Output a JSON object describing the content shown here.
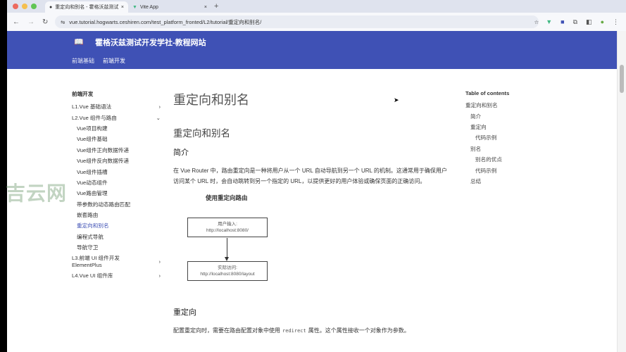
{
  "browser": {
    "tabs": [
      {
        "title": "重定向和别名 - 霍格沃兹测试开发学社",
        "active": true
      },
      {
        "title": "Vite App",
        "active": false
      }
    ],
    "url": "vue.tutorial.hogwarts.ceshiren.com/test_platform_fronted/L2/tutorial/重定向和别名/"
  },
  "header": {
    "site_title": "霍格沃兹测试开发学社-教程网站",
    "nav": [
      "前端基础",
      "前端开发"
    ]
  },
  "sidebar": {
    "heading": "前端开发",
    "items": [
      {
        "label": "L1.Vue 基础语法",
        "chevron": "›"
      },
      {
        "label": "L2.Vue 组件与路由",
        "chevron": "⌄"
      },
      {
        "label": "Vue项目构建",
        "sub": true
      },
      {
        "label": "Vue组件基础",
        "sub": true
      },
      {
        "label": "Vue组件正向数据传递",
        "sub": true
      },
      {
        "label": "Vue组件反向数据传递",
        "sub": true
      },
      {
        "label": "Vue组件插槽",
        "sub": true
      },
      {
        "label": "Vue动态组件",
        "sub": true
      },
      {
        "label": "Vue路由管理",
        "sub": true
      },
      {
        "label": "带参数的动态路由匹配",
        "sub": true
      },
      {
        "label": "嵌套路由",
        "sub": true
      },
      {
        "label": "重定向和别名",
        "sub": true,
        "active": true
      },
      {
        "label": "编程式导航",
        "sub": true
      },
      {
        "label": "导航守卫",
        "sub": true
      },
      {
        "label": "L3.前端 UI 组件开发 ElementPlus",
        "chevron": "›"
      },
      {
        "label": "L4.Vue UI 组件库",
        "chevron": "›"
      }
    ]
  },
  "main": {
    "title": "重定向和别名",
    "h2": "重定向和别名",
    "intro_heading": "简介",
    "intro_text": "在 Vue Router 中，路由重定向是一种将用户从一个 URL 自动导航到另一个 URL 的机制。这通常用于确保用户访问某个 URL 时，会自动跳转到另一个指定的 URL，以提供更好的用户体验或确保页面的正确访问。",
    "figure": {
      "title": "使用重定向路由",
      "box1_label": "用户输入:",
      "box1_url": "http://localhost:8080/",
      "box2_label": "实际访问:",
      "box2_url": "http://localhost:8080/layout"
    },
    "redirect_heading": "重定向",
    "redirect_text_before": "配置重定向时，需要在路由配置对象中使用",
    "redirect_code": "redirect",
    "redirect_text_after": "属性。这个属性接收一个对象作为参数。"
  },
  "toc": {
    "heading": "Table of contents",
    "items": [
      {
        "label": "重定向和别名",
        "level": 0
      },
      {
        "label": "简介",
        "level": 1
      },
      {
        "label": "重定向",
        "level": 1
      },
      {
        "label": "代码示例",
        "level": 2
      },
      {
        "label": "别名",
        "level": 1
      },
      {
        "label": "别名的优点",
        "level": 2
      },
      {
        "label": "代码示例",
        "level": 2
      },
      {
        "label": "总结",
        "level": 1
      }
    ]
  },
  "watermark": "吉云网",
  "colors": {
    "header": "#3f51b5",
    "active_link": "#3f51b5"
  }
}
